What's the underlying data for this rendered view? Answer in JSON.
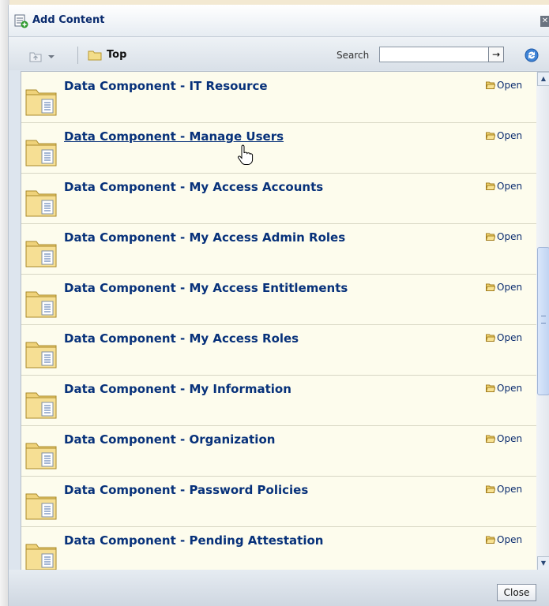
{
  "dialog": {
    "title": "Add Content",
    "title_icon": "add-content-icon",
    "close_icon": "close-icon"
  },
  "toolbar": {
    "up_icon": "up-folder-icon",
    "dropdown_icon": "chevron-down-icon",
    "breadcrumb_icon": "folder-icon",
    "breadcrumb_label": "Top",
    "search_label": "Search",
    "search_value": "",
    "go_icon": "arrow-right-icon",
    "go_label": "→",
    "refresh_icon": "refresh-icon"
  },
  "items": [
    {
      "name": "Data Component - IT Resource",
      "open_label": "Open",
      "hovered": false
    },
    {
      "name": "Data Component - Manage Users",
      "open_label": "Open",
      "hovered": true
    },
    {
      "name": "Data Component - My Access Accounts",
      "open_label": "Open",
      "hovered": false
    },
    {
      "name": "Data Component - My Access Admin Roles",
      "open_label": "Open",
      "hovered": false
    },
    {
      "name": "Data Component - My Access Entitlements",
      "open_label": "Open",
      "hovered": false
    },
    {
      "name": "Data Component - My Access Roles",
      "open_label": "Open",
      "hovered": false
    },
    {
      "name": "Data Component - My Information",
      "open_label": "Open",
      "hovered": false
    },
    {
      "name": "Data Component - Organization",
      "open_label": "Open",
      "hovered": false
    },
    {
      "name": "Data Component - Password Policies",
      "open_label": "Open",
      "hovered": false
    },
    {
      "name": "Data Component - Pending Attestation",
      "open_label": "Open",
      "hovered": false
    }
  ],
  "footer": {
    "close_label": "Close"
  },
  "colors": {
    "link": "#07317a",
    "list_bg": "#fdfced",
    "dialog_bg": "#dde5ee"
  }
}
